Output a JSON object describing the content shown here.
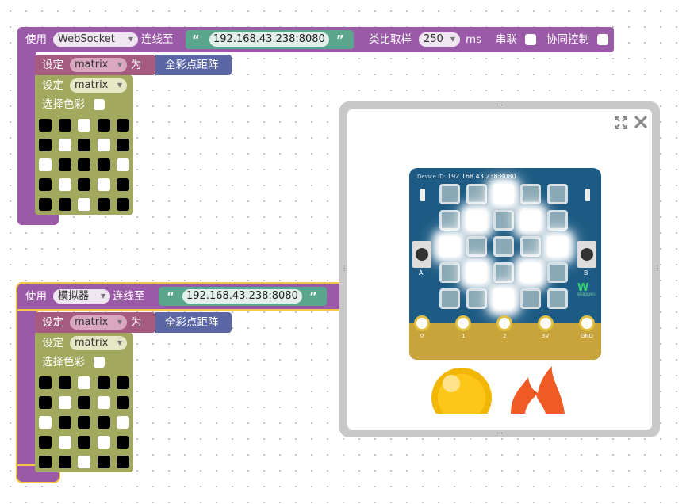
{
  "block1": {
    "use_label": "使用",
    "conn_type": "WebSocket",
    "connect_label": "连线至",
    "address": "192.168.43.238:8080",
    "sample_label": "类比取样",
    "sample_value": "250",
    "ms_label": "ms",
    "serial_label": "串联",
    "coop_label": "协同控制",
    "set_label": "设定",
    "var_name": "matrix",
    "as_label": "为",
    "matrix_func": "全彩点距阵",
    "inner_set_label": "设定",
    "inner_var": "matrix",
    "color_label": "选择色彩",
    "grid": [
      [
        0,
        0,
        1,
        0,
        0
      ],
      [
        0,
        1,
        0,
        1,
        0
      ],
      [
        1,
        0,
        0,
        0,
        1
      ],
      [
        0,
        1,
        0,
        1,
        0
      ],
      [
        0,
        0,
        1,
        0,
        0
      ]
    ]
  },
  "block2": {
    "use_label": "使用",
    "conn_type": "模拟器",
    "connect_label": "连线至",
    "address": "192.168.43.238:8080",
    "set_label": "设定",
    "var_name": "matrix",
    "as_label": "为",
    "matrix_func": "全彩点距阵",
    "inner_set_label": "设定",
    "inner_var": "matrix",
    "color_label": "选择色彩",
    "grid": [
      [
        0,
        0,
        1,
        0,
        0
      ],
      [
        0,
        1,
        0,
        1,
        0
      ],
      [
        1,
        0,
        0,
        0,
        1
      ],
      [
        0,
        1,
        0,
        1,
        0
      ],
      [
        0,
        0,
        1,
        0,
        0
      ]
    ]
  },
  "simulator": {
    "device_id_label": "Device ID:",
    "device_id": "192.168.43.238:8080",
    "button_a": "A",
    "button_b": "B",
    "pins": [
      "0",
      "1",
      "2",
      "3V",
      "GND"
    ],
    "brand": "WEBDUINO",
    "leds": [
      [
        0,
        0,
        1,
        0,
        0
      ],
      [
        0,
        1,
        0,
        1,
        0
      ],
      [
        1,
        0,
        0,
        0,
        1
      ],
      [
        0,
        1,
        0,
        1,
        0
      ],
      [
        0,
        0,
        1,
        0,
        0
      ]
    ],
    "expand_icon": "expand-icon",
    "close_icon": "close-icon"
  },
  "quote_open": "“",
  "quote_close": "”",
  "dropdown_arrow": "▼",
  "colors": {
    "purple": "#9b5aa8",
    "olive": "#a2a85e",
    "pink": "#a55b80",
    "blue": "#5b67a5",
    "green": "#5ba58c",
    "board": "#1d5b84",
    "selected": "#f3c74a"
  }
}
